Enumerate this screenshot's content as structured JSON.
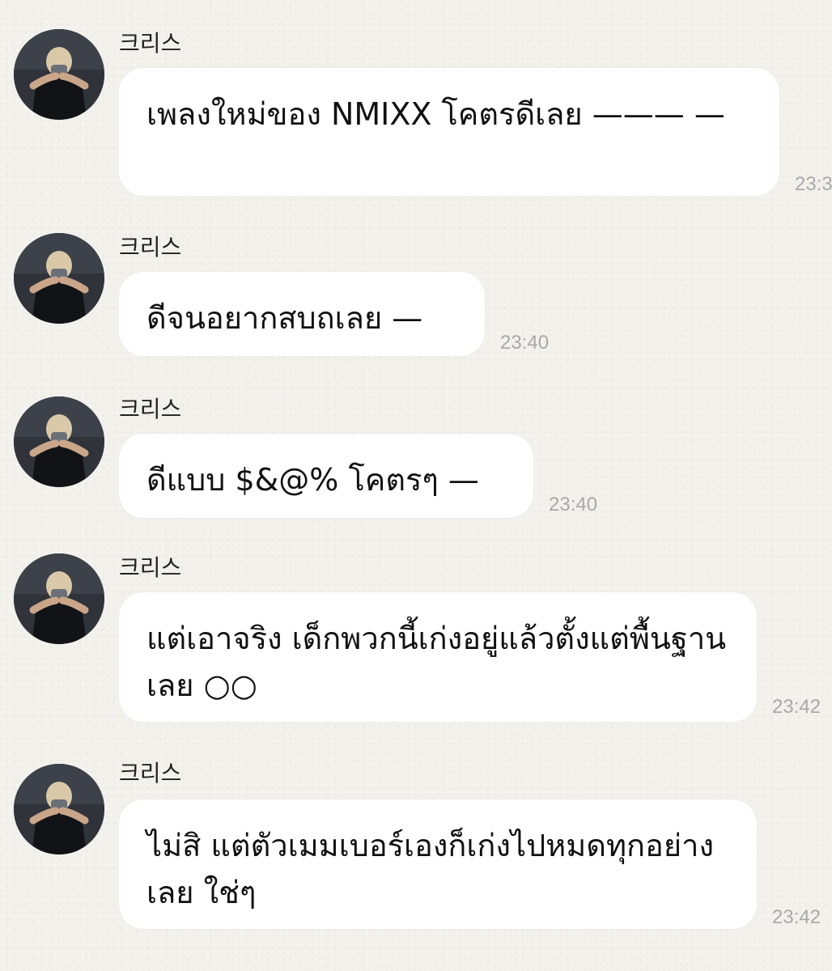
{
  "messages": [
    {
      "sender": "크리스",
      "text": "เพลงใหม่ของ NMIXX โคตรดีเลย ——— —",
      "time": "23:3"
    },
    {
      "sender": "크리스",
      "text": "ดีจนอยากสบถเลย —",
      "time": "23:40"
    },
    {
      "sender": "크리스",
      "text": "ดีแบบ $&@% โคตรๆ —",
      "time": "23:40"
    },
    {
      "sender": "크리스",
      "text": "แต่เอาจริง เด็กพวกนี้เก่งอยู่แล้วตั้งแต่พื้นฐานเลย ○○",
      "time": "23:42"
    },
    {
      "sender": "크리스",
      "text": "ไม่สิ แต่ตัวเมมเบอร์เองก็เก่งไปหมดทุกอย่างเลย ใช่ๆ",
      "time": "23:42"
    }
  ],
  "colors": {
    "background": "#f2f1ec",
    "bubble": "#ffffff",
    "timestamp": "#a9a9a9"
  },
  "icons": {
    "avatar": "profile-photo-icon"
  }
}
